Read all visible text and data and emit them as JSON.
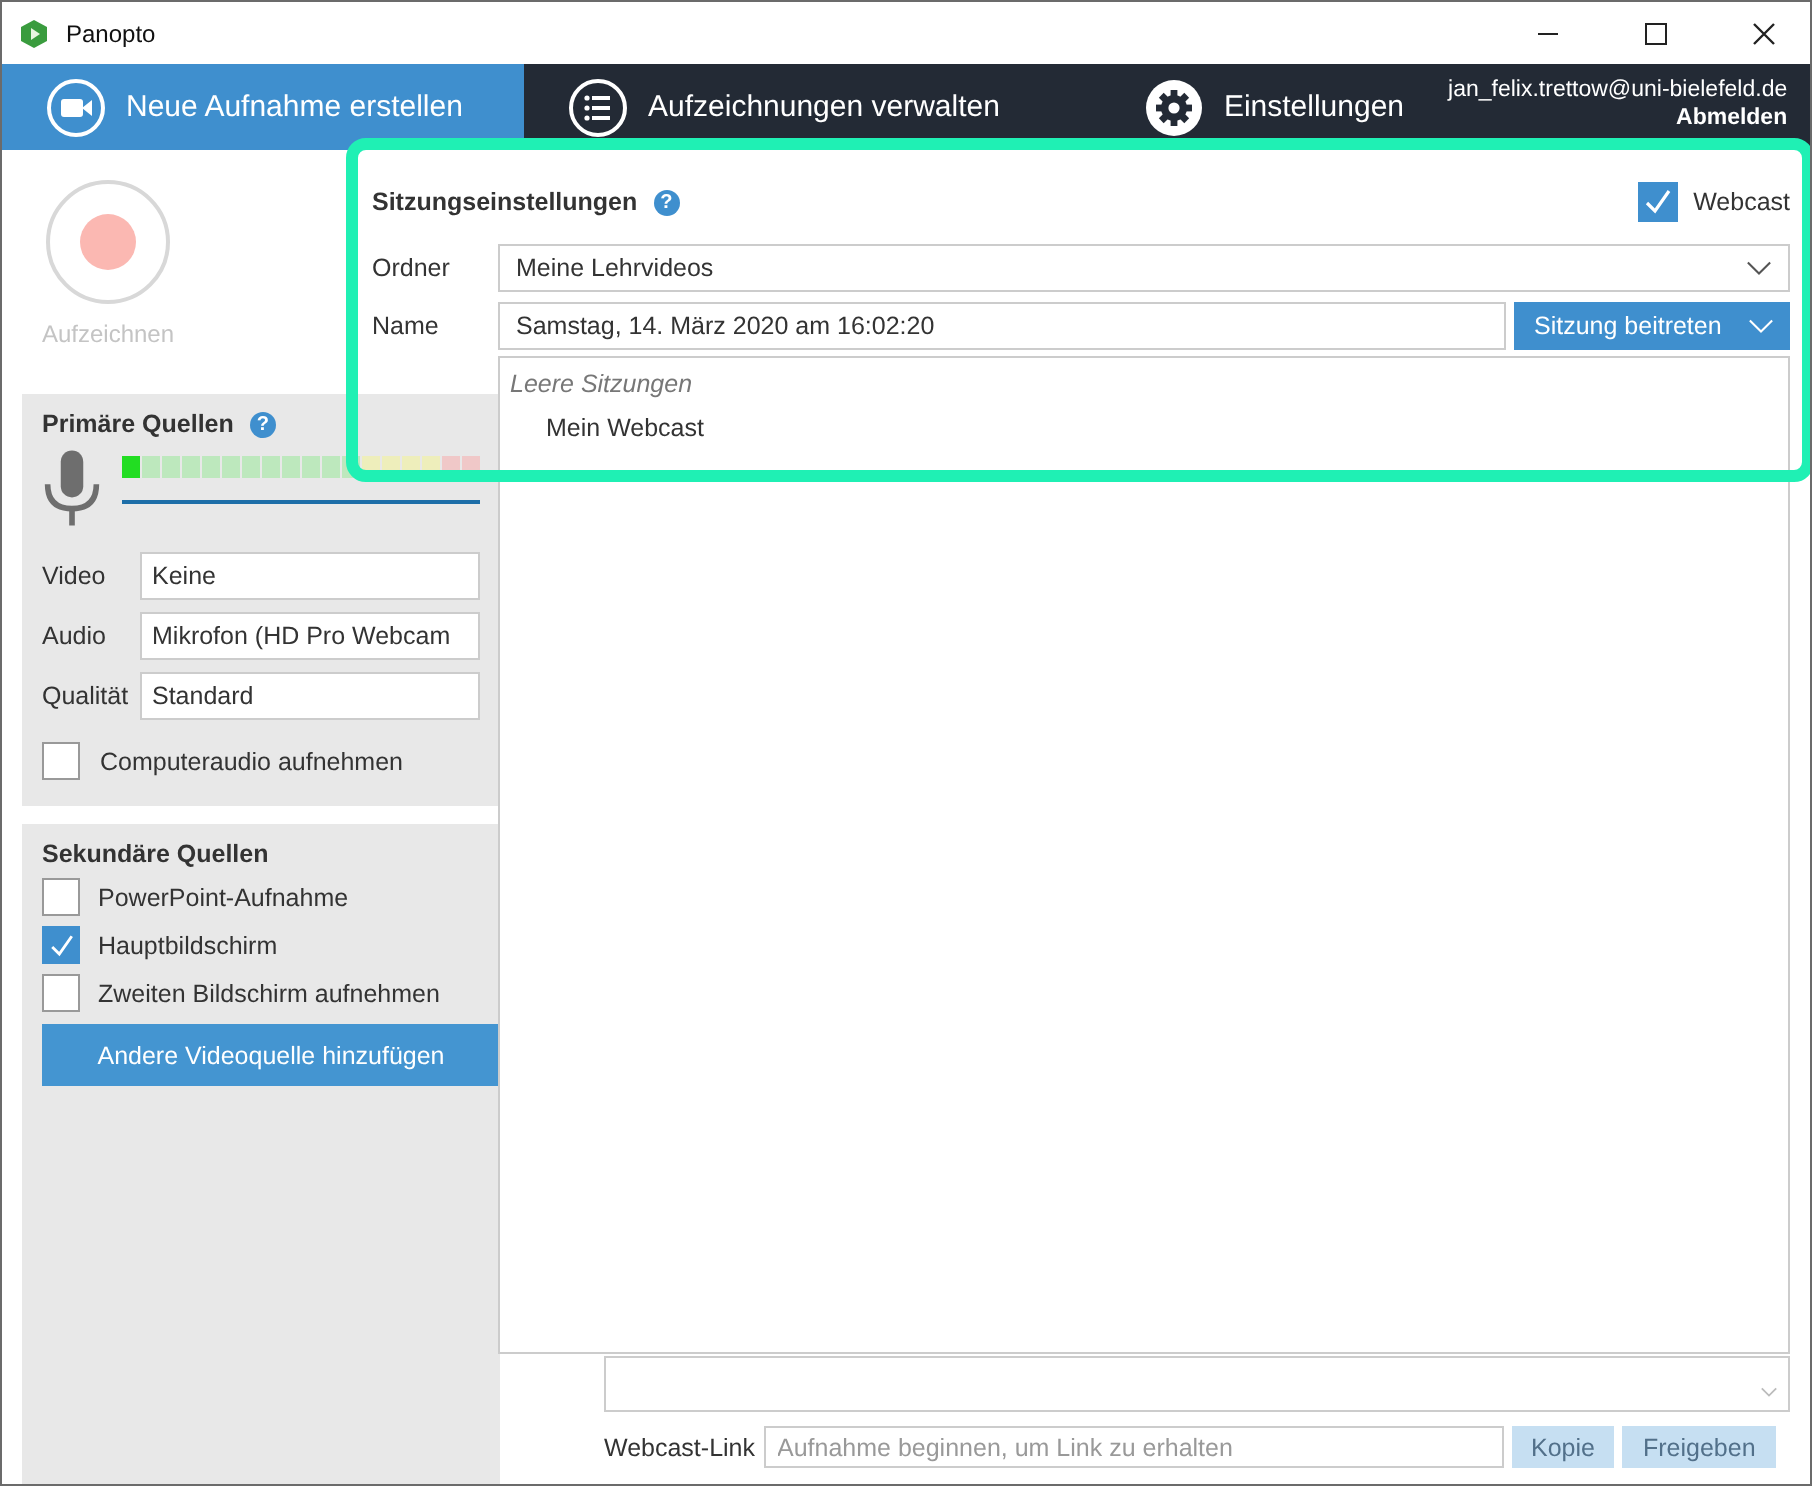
{
  "window": {
    "title": "Panopto"
  },
  "nav": {
    "tabs": [
      {
        "label": "Neue Aufnahme erstellen",
        "selected": true,
        "kind": "camera"
      },
      {
        "label": "Aufzeichnungen verwalten",
        "selected": false,
        "kind": "list"
      },
      {
        "label": "Einstellungen",
        "selected": false,
        "kind": "gear"
      }
    ],
    "user": {
      "email": "jan_felix.trettow@uni-bielefeld.de",
      "logout": "Abmelden"
    }
  },
  "record": {
    "label": "Aufzeichnen"
  },
  "session": {
    "title": "Sitzungseinstellungen",
    "help": "?",
    "webcast": {
      "label": "Webcast",
      "checked": true
    },
    "folder": {
      "label": "Ordner",
      "value": "Meine Lehrvideos"
    },
    "name": {
      "label": "Name",
      "value": "Samstag, 14. März 2020 am 16:02:20",
      "button": "Sitzung beitreten"
    },
    "dropdown": {
      "group": "Leere Sitzungen",
      "items": [
        "Mein Webcast"
      ]
    }
  },
  "primary": {
    "title": "Primäre Quellen",
    "help": "?",
    "meter": {
      "level": 0.06
    },
    "selects": [
      {
        "label": "Video",
        "value": "Keine"
      },
      {
        "label": "Audio",
        "value": "Mikrofon (HD Pro Webcam"
      },
      {
        "label": "Qualität",
        "value": "Standard"
      }
    ],
    "computer_audio": {
      "label": "Computeraudio aufnehmen",
      "checked": false
    }
  },
  "secondary": {
    "title": "Sekundäre Quellen",
    "options": [
      {
        "label": "PowerPoint-Aufnahme",
        "checked": false
      },
      {
        "label": "Hauptbildschirm",
        "checked": true
      },
      {
        "label": "Zweiten Bildschirm aufnehmen",
        "checked": false
      }
    ],
    "add_button": "Andere Videoquelle hinzufügen"
  },
  "webcast_link": {
    "label": "Webcast-Link",
    "placeholder": "Aufnahme beginnen, um Link zu erhalten",
    "buttons": [
      {
        "label": "Kopie",
        "disabled": true
      },
      {
        "label": "Freigeben",
        "disabled": true
      }
    ]
  }
}
